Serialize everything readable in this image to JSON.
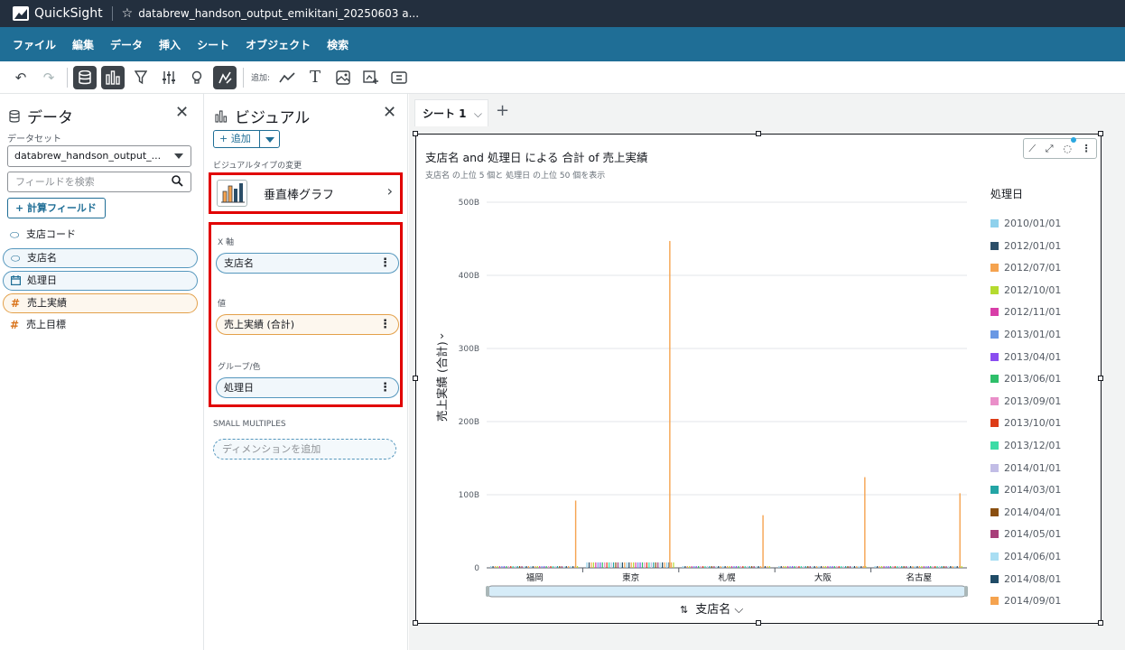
{
  "app": {
    "brand": "QuickSight",
    "doc_title": "databrew_handson_output_emikitani_20250603 a..."
  },
  "menu": [
    "ファイル",
    "編集",
    "データ",
    "挿入",
    "シート",
    "オブジェクト",
    "検索"
  ],
  "toolbar": {
    "add_label": "追加:"
  },
  "data_panel": {
    "title": "データ",
    "dataset_label": "データセット",
    "dataset_value": "databrew_handson_output_...",
    "search_placeholder": "フィールドを検索",
    "calc_button": "+ 計算フィールド",
    "fields": [
      {
        "name": "支店コード",
        "type": "dimension",
        "selected": false
      },
      {
        "name": "支店名",
        "type": "dimension",
        "selected": true
      },
      {
        "name": "処理日",
        "type": "date",
        "selected": true
      },
      {
        "name": "売上実績",
        "type": "measure",
        "selected": true
      },
      {
        "name": "売上目標",
        "type": "measure",
        "selected": false
      }
    ]
  },
  "visual_panel": {
    "title": "ビジュアル",
    "add_button": "+ 追加",
    "type_label": "ビジュアルタイプの変更",
    "type_name": "垂直棒グラフ",
    "wells": {
      "x_label": "X 軸",
      "x_value": "支店名",
      "value_label": "値",
      "value_value": "売上実績 (合計)",
      "group_label": "グループ/色",
      "group_value": "処理日"
    },
    "small_multiples_label": "SMALL MULTIPLES",
    "small_multiples_placeholder": "ディメンションを追加"
  },
  "sheet": {
    "tab": "シート 1"
  },
  "visual": {
    "title": "支店名 and 処理日 による 合計 of 売上実績",
    "subtitle": "支店名 の上位 5 個と 処理日 の上位 50 個を表示",
    "legend_title": "処理日",
    "x_title": "支店名",
    "y_title": "売上実績 (合計)"
  },
  "chart_data": {
    "type": "bar",
    "categories": [
      "福岡",
      "東京",
      "札幌",
      "大阪",
      "名古屋"
    ],
    "y_ticks": [
      "0",
      "100B",
      "200B",
      "300B",
      "400B",
      "500B"
    ],
    "ylim": [
      0,
      500000000000
    ],
    "spikes": [
      {
        "category": "福岡",
        "value": 92000000000,
        "color": "#f5a34f"
      },
      {
        "category": "東京",
        "value": 447000000000,
        "color": "#f5a34f"
      },
      {
        "category": "札幌",
        "value": 72000000000,
        "color": "#f5a34f"
      },
      {
        "category": "大阪",
        "value": 124000000000,
        "color": "#f5a34f"
      },
      {
        "category": "名古屋",
        "value": 102000000000,
        "color": "#f5a34f"
      }
    ],
    "legend": [
      {
        "label": "2010/01/01",
        "color": "#8fd1ec"
      },
      {
        "label": "2012/01/01",
        "color": "#2b4e68"
      },
      {
        "label": "2012/07/01",
        "color": "#f5a34f"
      },
      {
        "label": "2012/10/01",
        "color": "#b5db2f"
      },
      {
        "label": "2012/11/01",
        "color": "#d83ea8"
      },
      {
        "label": "2013/01/01",
        "color": "#6a98e4"
      },
      {
        "label": "2013/04/01",
        "color": "#8a4df0"
      },
      {
        "label": "2013/06/01",
        "color": "#2ebf6a"
      },
      {
        "label": "2013/09/01",
        "color": "#ea8fc9"
      },
      {
        "label": "2013/10/01",
        "color": "#dd3c17"
      },
      {
        "label": "2013/12/01",
        "color": "#3cdca6"
      },
      {
        "label": "2014/01/01",
        "color": "#c2bde6"
      },
      {
        "label": "2014/03/01",
        "color": "#24a5a5"
      },
      {
        "label": "2014/04/01",
        "color": "#8a4f10"
      },
      {
        "label": "2014/05/01",
        "color": "#a83f7a"
      },
      {
        "label": "2014/06/01",
        "color": "#a9def3"
      },
      {
        "label": "2014/08/01",
        "color": "#1f4b66"
      },
      {
        "label": "2014/09/01",
        "color": "#f5a34f"
      }
    ]
  }
}
